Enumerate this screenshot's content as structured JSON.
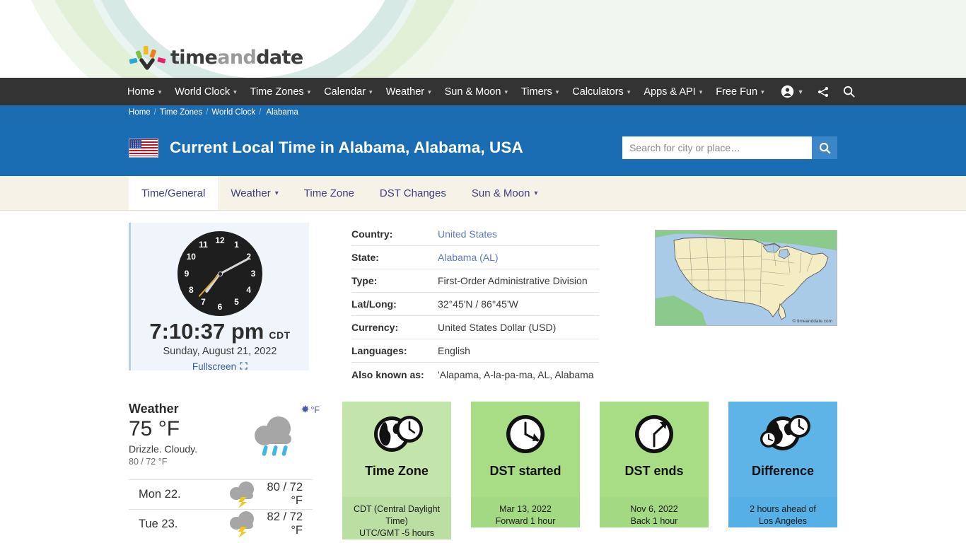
{
  "brand": {
    "part1": "time",
    "part2": "and",
    "part3": "date"
  },
  "nav": {
    "items": [
      {
        "label": "Home",
        "caret": true
      },
      {
        "label": "World Clock",
        "caret": true
      },
      {
        "label": "Time Zones",
        "caret": true
      },
      {
        "label": "Calendar",
        "caret": true
      },
      {
        "label": "Weather",
        "caret": true
      },
      {
        "label": "Sun & Moon",
        "caret": true
      },
      {
        "label": "Timers",
        "caret": true
      },
      {
        "label": "Calculators",
        "caret": true
      },
      {
        "label": "Apps & API",
        "caret": true
      },
      {
        "label": "Free Fun",
        "caret": true
      }
    ],
    "icons": [
      "account-icon",
      "share-icon",
      "search-icon"
    ]
  },
  "breadcrumb": {
    "items": [
      "Home",
      "Time Zones",
      "World Clock"
    ],
    "current": "Alabama",
    "separator": "/"
  },
  "header": {
    "flag": "us-flag-icon",
    "title": "Current Local Time in Alabama, Alabama, USA"
  },
  "search": {
    "placeholder": "Search for city or place…",
    "value": "",
    "button_icon": "search-icon"
  },
  "tabs": [
    {
      "label": "Time/General",
      "active": true,
      "caret": false
    },
    {
      "label": "Weather",
      "active": false,
      "caret": true
    },
    {
      "label": "Time Zone",
      "active": false,
      "caret": false
    },
    {
      "label": "DST Changes",
      "active": false,
      "caret": false
    },
    {
      "label": "Sun & Moon",
      "active": false,
      "caret": true
    }
  ],
  "clock": {
    "time": "7:10:37 pm",
    "timezone_abbr": "CDT",
    "date": "Sunday, August 21, 2022",
    "fullscreen_label": "Fullscreen",
    "numerals": [
      "12",
      "1",
      "2",
      "3",
      "4",
      "5",
      "6",
      "7",
      "8",
      "9",
      "10",
      "11"
    ],
    "hour_deg": 216,
    "minute_deg": 62,
    "second_deg": 222
  },
  "info": {
    "rows": [
      {
        "key": "Country:",
        "value": "United States",
        "link": true
      },
      {
        "key": "State:",
        "value": "Alabama (AL)",
        "link": true
      },
      {
        "key": "Type:",
        "value": "First-Order Administrative Division",
        "link": false
      },
      {
        "key": "Lat/Long:",
        "value": "32°45'N / 86°45'W",
        "link": false
      },
      {
        "key": "Currency:",
        "value": "United States Dollar (USD)",
        "link": false
      },
      {
        "key": "Languages:",
        "value": "English",
        "link": false
      },
      {
        "key": "Also known as:",
        "value": "'Alapama, A-la-pa-ma, AL, Alabama",
        "link": false
      }
    ]
  },
  "map": {
    "credit": "© timeanddate.com",
    "alt": "us-map"
  },
  "weather": {
    "title": "Weather",
    "temp": "75 °F",
    "description": "Drizzle. Cloudy.",
    "hilo": "80 / 72 °F",
    "unit_toggle": "°F",
    "gear_icon": "gear-icon",
    "current_icon": "rain-cloud-icon",
    "forecast": [
      {
        "day": "Mon 22.",
        "icon": "thunderstorm-icon",
        "temp": "80 / 72 °F"
      },
      {
        "day": "Tue 23.",
        "icon": "thunderstorm-icon",
        "temp": "82 / 72 °F"
      }
    ]
  },
  "cards": [
    {
      "name": "time-zone",
      "icon": "globe-clock-icon",
      "title": "Time Zone",
      "line1": "CDT (Central Daylight Time)",
      "line2": "UTC/GMT -5 hours",
      "color": "#c3e4ab"
    },
    {
      "name": "dst-started",
      "icon": "clock-forward-icon",
      "title": "DST started",
      "line1": "Mar 13, 2022",
      "line2": "Forward 1 hour",
      "color": "#a8dd86"
    },
    {
      "name": "dst-ends",
      "icon": "clock-back-icon",
      "title": "DST ends",
      "line1": "Nov 6, 2022",
      "line2": "Back 1 hour",
      "color": "#a8dd86"
    },
    {
      "name": "difference",
      "icon": "globes-clocks-icon",
      "title": "Difference",
      "line1": "2 hours ahead of",
      "line2": "Los Angeles",
      "color": "#5eb4e7"
    }
  ],
  "colors": {
    "nav_bg": "#333333",
    "title_bg": "#1a6cb3",
    "breadcrumb_bg": "#1c6cb1",
    "tabbar_bg": "#f7f2e7",
    "link": "#5b7cc2",
    "clockcard_bg": "#f0f5fb"
  }
}
